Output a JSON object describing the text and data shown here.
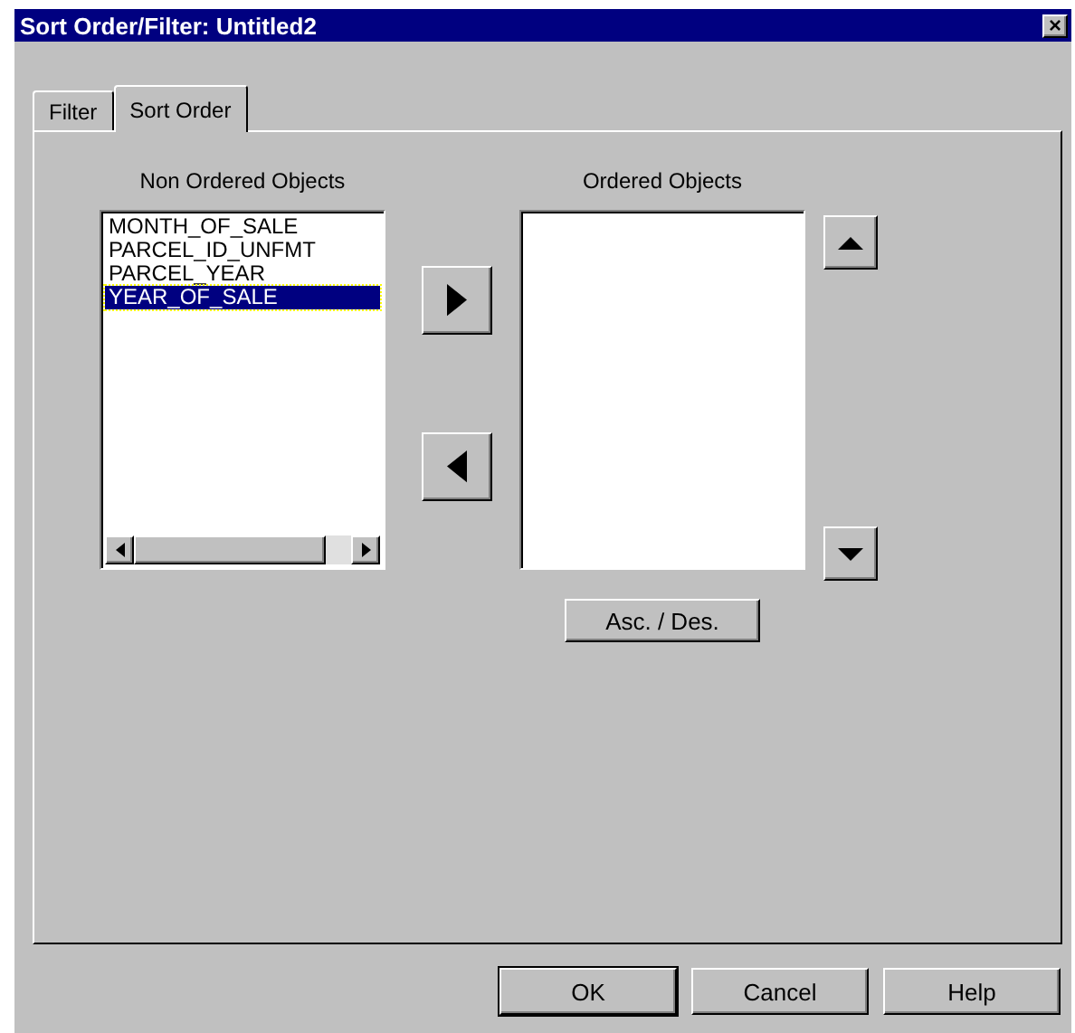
{
  "window": {
    "title": "Sort Order/Filter: Untitled2",
    "close": "×"
  },
  "tabs": [
    {
      "label": "Filter",
      "selected": false
    },
    {
      "label": "Sort Order",
      "selected": true
    }
  ],
  "non_ordered": {
    "label": "Non Ordered Objects",
    "items": [
      {
        "text": "MONTH_OF_SALE",
        "selected": false
      },
      {
        "text": "PARCEL_ID_UNFMT",
        "selected": false
      },
      {
        "text": "PARCEL_YEAR",
        "selected": false
      },
      {
        "text": "YEAR_OF_SALE",
        "selected": true
      }
    ]
  },
  "ordered": {
    "label": "Ordered Objects"
  },
  "asc_des": "Asc. / Des.",
  "buttons": [
    {
      "label": "OK",
      "default": true
    },
    {
      "label": "Cancel",
      "default": false
    },
    {
      "label": "Help",
      "default": false
    }
  ]
}
